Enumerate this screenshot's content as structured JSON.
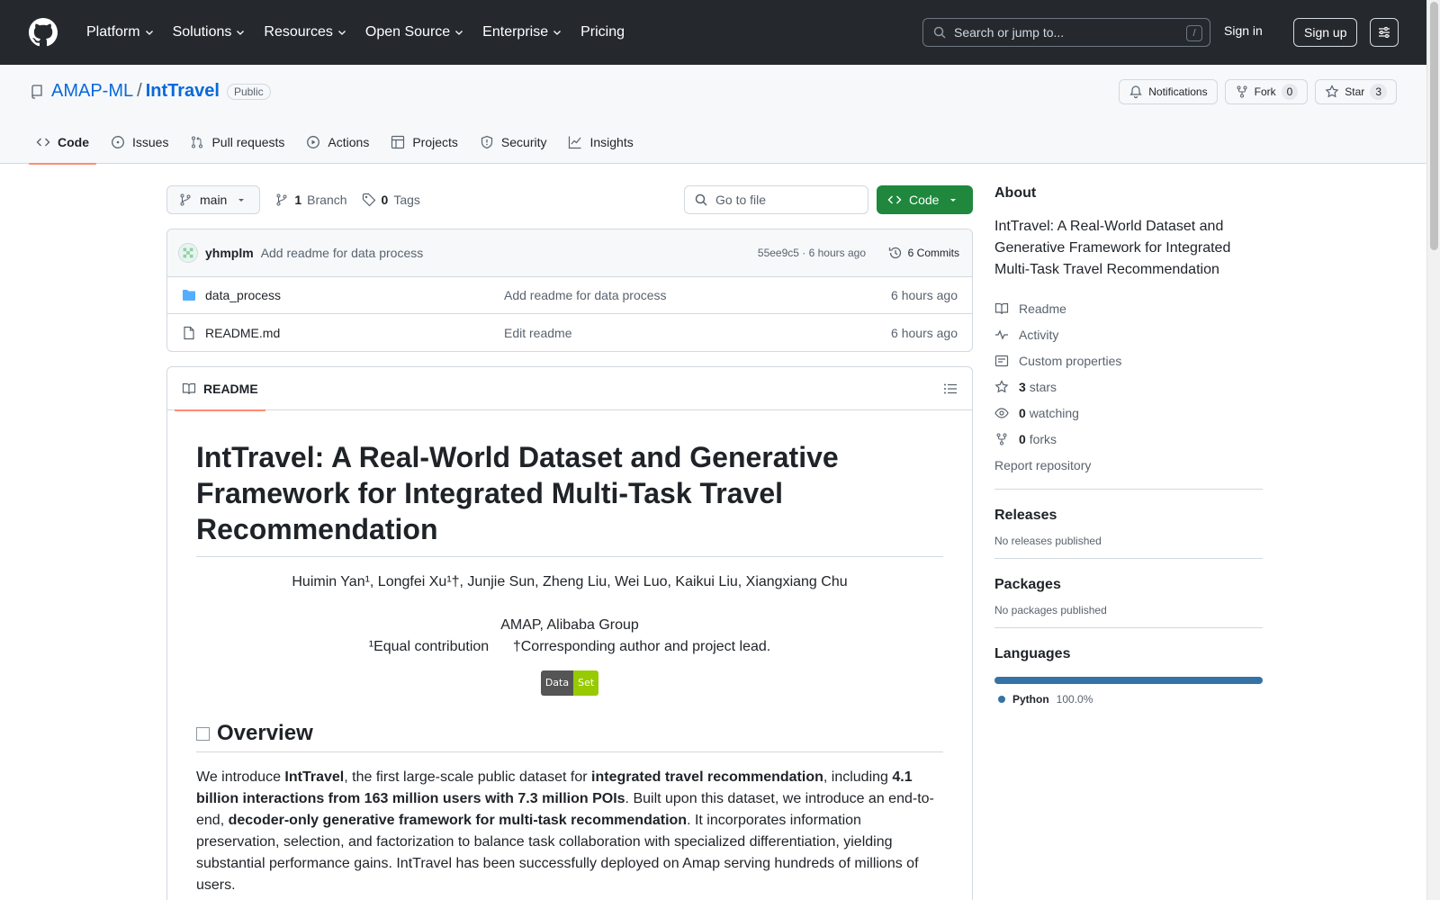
{
  "header": {
    "nav": [
      "Platform",
      "Solutions",
      "Resources",
      "Open Source",
      "Enterprise",
      "Pricing"
    ],
    "search_placeholder": "Search or jump to...",
    "search_shortcut": "/",
    "sign_in": "Sign in",
    "sign_up": "Sign up"
  },
  "repo": {
    "owner": "AMAP-ML",
    "separator": "/",
    "name": "IntTravel",
    "visibility": "Public",
    "notifications_label": "Notifications",
    "fork_label": "Fork",
    "fork_count": "0",
    "star_label": "Star",
    "star_count": "3",
    "tabs": [
      "Code",
      "Issues",
      "Pull requests",
      "Actions",
      "Projects",
      "Security",
      "Insights"
    ]
  },
  "toolbar": {
    "branch": "main",
    "branch_count": "1",
    "branch_label": "Branch",
    "tag_count": "0",
    "tag_label": "Tags",
    "goto_file": "Go to file",
    "code_button": "Code"
  },
  "commit": {
    "author": "yhmplm",
    "message": "Add readme for data process",
    "meta": "55ee9c5 · 6 hours ago",
    "commits_label": "6 Commits"
  },
  "files": [
    {
      "name": "data_process",
      "type": "folder",
      "commit": "Add readme for data process",
      "time": "6 hours ago"
    },
    {
      "name": "README.md",
      "type": "file",
      "commit": "Edit readme",
      "time": "6 hours ago"
    }
  ],
  "readme": {
    "tab_label": "README",
    "title": "IntTravel: A Real-World Dataset and Generative Framework for Integrated Multi-Task Travel Recommendation",
    "authors": "Huimin Yan¹, Longfei Xu¹†, Junjie Sun, Zheng Liu, Wei Luo, Kaikui Liu, Xiangxiang Chu",
    "affiliation": "AMAP, Alibaba Group",
    "contribution_note": "¹Equal contribution      †Corresponding author and project lead.",
    "badge_left": "Data",
    "badge_right": "Set",
    "overview_heading": "Overview",
    "overview": {
      "t1": "We introduce ",
      "b1": "IntTravel",
      "t2": ", the first large-scale public dataset for ",
      "b2": "integrated travel recommendation",
      "t3": ", including ",
      "b3": "4.1 billion interactions from 163 million users with 7.3 million POIs",
      "t4": ". Built upon this dataset, we introduce an end-to-end, ",
      "b4": "decoder-only generative framework for multi-task recommendation",
      "t5": ". It incorporates information preservation, selection, and factorization to balance task collaboration with specialized differentiation, yielding substantial performance gains. IntTravel has been successfully deployed on Amap serving hundreds of millions of users."
    }
  },
  "sidebar": {
    "about_heading": "About",
    "description": "IntTravel: A Real-World Dataset and Generative Framework for Integrated Multi-Task Travel Recommendation",
    "readme": "Readme",
    "activity": "Activity",
    "custom_properties": "Custom properties",
    "stars_count": "3",
    "stars_label": "stars",
    "watching_count": "0",
    "watching_label": "watching",
    "forks_count": "0",
    "forks_label": "forks",
    "report": "Report repository",
    "releases_heading": "Releases",
    "releases_note": "No releases published",
    "packages_heading": "Packages",
    "packages_note": "No packages published",
    "languages_heading": "Languages",
    "language": "Python",
    "language_pct": "100.0%",
    "language_color": "#3572a5"
  }
}
